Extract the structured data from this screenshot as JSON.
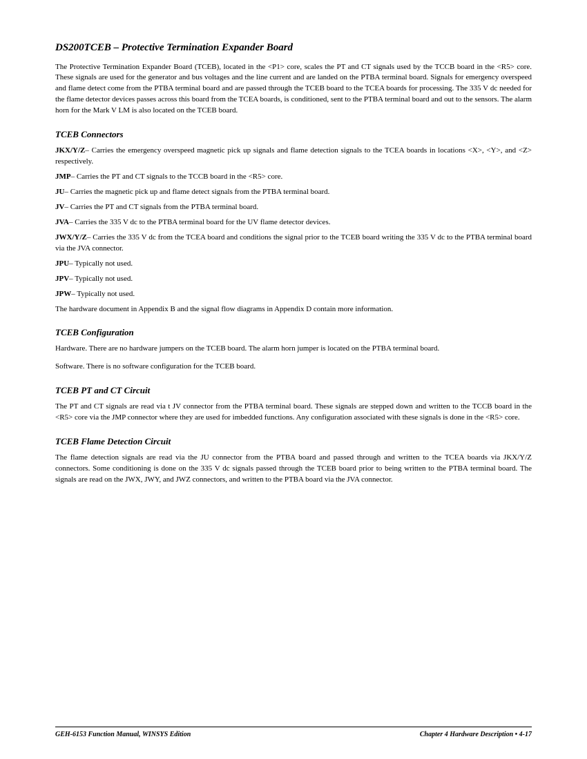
{
  "page": {
    "main_title": "DS200TCEB – Protective Termination Expander Board",
    "intro_paragraph": "The Protective Termination Expander Board (TCEB), located in the <P1> core, scales the PT and CT signals used by the TCCB board in the <R5> core. These signals are used for the generator and bus voltages and the line current and are landed on the PTBA terminal board. Signals for emergency overspeed and flame detect come from the PTBA terminal board and are passed through the TCEB board to the TCEA boards for processing. The 335 V dc needed for the flame detector devices passes across this board from the TCEA boards, is conditioned, sent to the PTBA terminal board and out to the sensors. The alarm horn for the Mark V LM is also located on the TCEB board.",
    "sections": [
      {
        "title": "TCEB Connectors",
        "entries": [
          {
            "label": "JKX/Y/Z",
            "text": "– Carries the emergency overspeed magnetic pick up signals and flame detection signals to the TCEA boards in locations <X>, <Y>, and <Z> respectively."
          },
          {
            "label": "JMP",
            "text": "– Carries the PT and CT signals to the TCCB board in the <R5> core."
          },
          {
            "label": "JU",
            "text": "– Carries the magnetic pick up and flame detect signals from the PTBA terminal board."
          },
          {
            "label": "JV",
            "text": "– Carries the PT and CT signals from the PTBA terminal board."
          },
          {
            "label": "JVA",
            "text": "– Carries the 335 V dc to the PTBA terminal board for the UV flame detector devices."
          },
          {
            "label": "JWX/Y/Z",
            "text": "– Carries the 335 V dc from the TCEA board and conditions the signal prior to the TCEB board writing the 335 V dc to the PTBA terminal board via the JVA connector."
          },
          {
            "label": "JPU",
            "text": "– Typically not used."
          },
          {
            "label": "JPV",
            "text": "– Typically not used."
          },
          {
            "label": "JPW",
            "text": "– Typically not used."
          }
        ],
        "closing_text": "The hardware document in Appendix B and the signal flow diagrams in Appendix D contain more information."
      },
      {
        "title": "TCEB Configuration",
        "paragraphs": [
          "Hardware. There are no hardware jumpers on the TCEB board. The alarm horn jumper is located on the PTBA terminal board.",
          "Software. There is no software configuration for the TCEB board."
        ]
      },
      {
        "title": "TCEB PT and CT Circuit",
        "paragraphs": [
          "The PT and CT signals are read via t JV connector from the PTBA terminal board. These signals are stepped down and written to the TCCB board in the <R5> core via the JMP connector where they are used for imbedded functions. Any configuration associated with these signals is done in the <R5> core."
        ]
      },
      {
        "title": "TCEB Flame Detection Circuit",
        "paragraphs": [
          "The flame detection signals are read via the JU connector from the PTBA board and passed through and written to the TCEA boards via JKX/Y/Z connectors. Some conditioning is done on the 335 V dc signals passed through the TCEB board prior to being written to the PTBA terminal board. The signals are read on the JWX, JWY, and JWZ connectors, and written to the PTBA board via the JVA connector."
        ]
      }
    ],
    "footer": {
      "left": "GEH-6153   Function Manual, WINSYS Edition",
      "right": "Chapter 4   Hardware Description • 4-17"
    }
  }
}
